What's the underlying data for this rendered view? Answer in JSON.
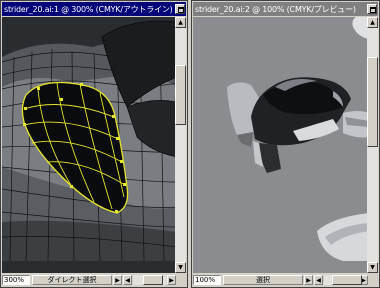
{
  "window_a": {
    "title": "strider_20.ai:1 @ 300% (CMYK/アウトライン)",
    "zoom": "300%",
    "tool": "ダイレクト選択"
  },
  "window_b": {
    "title": "strider_20.ai:2 @ 100% (CMYK/プレビュー)",
    "zoom": "100%",
    "tool": "選択"
  },
  "icons": {
    "scroll_up": "▲",
    "scroll_down": "▼",
    "scroll_left": "◀",
    "scroll_right": "▶"
  },
  "colors": {
    "active_title": "#000078",
    "inactive_title": "#808080",
    "selection": "#e6e62a"
  }
}
